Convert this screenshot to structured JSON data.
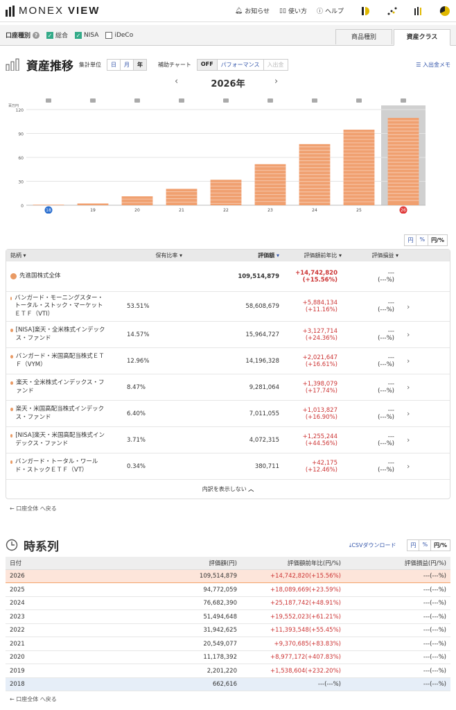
{
  "header": {
    "logo_light": "MONEX",
    "logo_bold": "VIEW",
    "nav": [
      "お知らせ",
      "使い方",
      "ヘルプ"
    ]
  },
  "account": {
    "label": "口座種別",
    "options": [
      {
        "label": "総合",
        "checked": true
      },
      {
        "label": "NISA",
        "checked": true
      },
      {
        "label": "iDeCo",
        "checked": false
      }
    ],
    "tabs": [
      "商品種別",
      "資産クラス"
    ],
    "active_tab": "資産クラス"
  },
  "asset": {
    "title": "資産推移",
    "unit_label": "集計単位",
    "units": [
      "日",
      "月",
      "年"
    ],
    "active_unit": "年",
    "aux_label": "補助チャート",
    "aux": [
      "OFF",
      "パフォーマンス",
      "入出金"
    ],
    "memo": "入出金メモ",
    "year": "2026年"
  },
  "chart_data": {
    "type": "bar",
    "ylabel": "百万円",
    "yticks": [
      0,
      30,
      60,
      90,
      120
    ],
    "ylim": [
      0,
      120
    ],
    "categories": [
      "18",
      "19",
      "20",
      "21",
      "22",
      "23",
      "24",
      "25",
      "26"
    ],
    "values": [
      0.66,
      2.2,
      11.18,
      20.55,
      31.94,
      51.49,
      76.68,
      94.77,
      109.51
    ],
    "highlight": "26",
    "colors": {
      "bar": "#f0a070",
      "stripe": "#fbe3d3",
      "highlight_bg": "#d0d0d0",
      "start": "#2a6ecf",
      "end": "#e03a3a"
    }
  },
  "units_toggle": [
    "円",
    "%",
    "円/%"
  ],
  "portfolio": {
    "columns": {
      "name": "銘柄",
      "ratio": "保有比率",
      "value": "評価額",
      "change": "評価額前年比",
      "gain": "評価損益"
    },
    "total": {
      "name": "先進国株式全体",
      "value": "109,514,879",
      "change": "+14,742,820",
      "change_pct": "(+15.56%)",
      "gain": "---",
      "gain_pct": "(---%)"
    },
    "rows": [
      {
        "name": "バンガード・モーニングスター・トータル・ストック・マーケットＥＴＦ（VTI）",
        "ratio": "53.51%",
        "value": "58,608,679",
        "change": "+5,884,134",
        "change_pct": "(+11.16%)",
        "gain": "---",
        "gain_pct": "(---%)"
      },
      {
        "name": "[NISA]楽天・全米株式インデックス・ファンド",
        "ratio": "14.57%",
        "value": "15,964,727",
        "change": "+3,127,714",
        "change_pct": "(+24.36%)",
        "gain": "---",
        "gain_pct": "(---%)"
      },
      {
        "name": "バンガード・米国高配当株式ＥＴＦ（VYM）",
        "ratio": "12.96%",
        "value": "14,196,328",
        "change": "+2,021,647",
        "change_pct": "(+16.61%)",
        "gain": "---",
        "gain_pct": "(---%)"
      },
      {
        "name": "楽天・全米株式インデックス・ファンド",
        "ratio": "8.47%",
        "value": "9,281,064",
        "change": "+1,398,079",
        "change_pct": "(+17.74%)",
        "gain": "---",
        "gain_pct": "(---%)"
      },
      {
        "name": "楽天・米国高配当株式インデックス・ファンド",
        "ratio": "6.40%",
        "value": "7,011,055",
        "change": "+1,013,827",
        "change_pct": "(+16.90%)",
        "gain": "---",
        "gain_pct": "(---%)"
      },
      {
        "name": "[NISA]楽天・米国高配当株式インデックス・ファンド",
        "ratio": "3.71%",
        "value": "4,072,315",
        "change": "+1,255,244",
        "change_pct": "(+44.56%)",
        "gain": "---",
        "gain_pct": "(---%)"
      },
      {
        "name": "バンガード・トータル・ワールド・ストックＥＴＦ（VT）",
        "ratio": "0.34%",
        "value": "380,711",
        "change": "+42,175",
        "change_pct": "(+12.46%)",
        "gain": "---",
        "gain_pct": "(---%)"
      }
    ],
    "collapse": "内訳を表示しない",
    "back": "← 口座全体 へ戻る"
  },
  "timeseries": {
    "title": "時系列",
    "csv": "CSVダウンロード",
    "columns": [
      "日付",
      "評価額(円)",
      "評価額前年比(円/%)",
      "評価損益(円/%)"
    ],
    "rows": [
      {
        "date": "2026",
        "value": "109,514,879",
        "change": "+14,742,820(+15.56%)",
        "gain": "---(---%)"
      },
      {
        "date": "2025",
        "value": "94,772,059",
        "change": "+18,089,669(+23.59%)",
        "gain": "---(---%)"
      },
      {
        "date": "2024",
        "value": "76,682,390",
        "change": "+25,187,742(+48.91%)",
        "gain": "---(---%)"
      },
      {
        "date": "2023",
        "value": "51,494,648",
        "change": "+19,552,023(+61.21%)",
        "gain": "---(---%)"
      },
      {
        "date": "2022",
        "value": "31,942,625",
        "change": "+11,393,548(+55.45%)",
        "gain": "---(---%)"
      },
      {
        "date": "2021",
        "value": "20,549,077",
        "change": "+9,370,685(+83.83%)",
        "gain": "---(---%)"
      },
      {
        "date": "2020",
        "value": "11,178,392",
        "change": "+8,977,172(+407.83%)",
        "gain": "---(---%)"
      },
      {
        "date": "2019",
        "value": "2,201,220",
        "change": "+1,538,604(+232.20%)",
        "gain": "---(---%)"
      },
      {
        "date": "2018",
        "value": "662,616",
        "change": "---(---%)",
        "gain": "---(---%)"
      }
    ],
    "back": "← 口座全体 へ戻る"
  }
}
